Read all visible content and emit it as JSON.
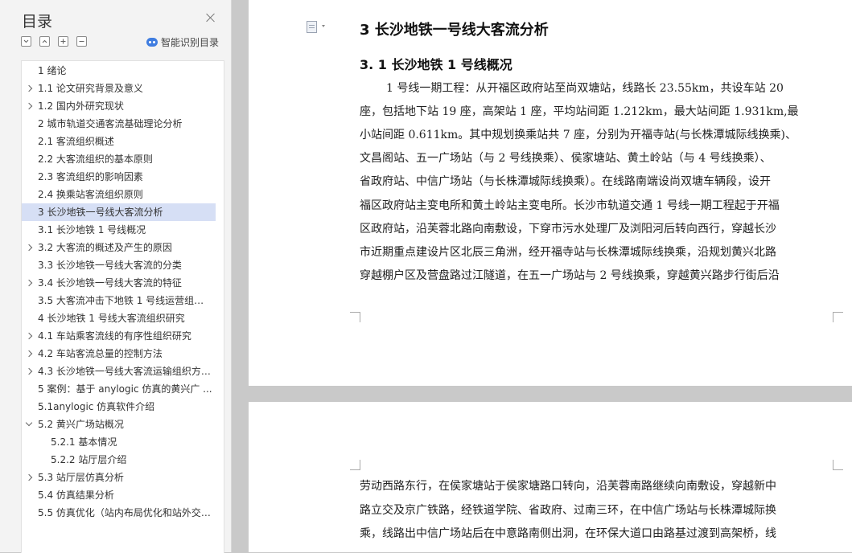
{
  "sidebar": {
    "title": "目录",
    "smart_label": "智能识别目录",
    "items": [
      {
        "label": "1 绪论",
        "expandable": false,
        "level": 1
      },
      {
        "label": "1.1 论文研究背景及意义",
        "expandable": true,
        "level": 1
      },
      {
        "label": "1.2 国内外研究现状",
        "expandable": true,
        "level": 1
      },
      {
        "label": "2 城市轨道交通客流基础理论分析",
        "expandable": false,
        "level": 1
      },
      {
        "label": "2.1 客流组织概述",
        "expandable": false,
        "level": 1
      },
      {
        "label": "2.2 大客流组织的基本原则",
        "expandable": false,
        "level": 1
      },
      {
        "label": "2.3 客流组织的影响因素",
        "expandable": false,
        "level": 1
      },
      {
        "label": "2.4 换乘站客流组织原则",
        "expandable": false,
        "level": 1
      },
      {
        "label": "3 长沙地铁一号线大客流分析",
        "expandable": false,
        "level": 1,
        "selected": true
      },
      {
        "label": "3.1 长沙地铁 1 号线概况",
        "expandable": false,
        "level": 1
      },
      {
        "label": "3.2 大客流的概述及产生的原因",
        "expandable": true,
        "level": 1
      },
      {
        "label": "3.3 长沙地铁一号线大客流的分类",
        "expandable": false,
        "level": 1
      },
      {
        "label": "3.4 长沙地铁一号线大客流的特征",
        "expandable": true,
        "level": 1
      },
      {
        "label": "3.5 大客流冲击下地铁 1 号线运营组织 ...",
        "expandable": false,
        "level": 1
      },
      {
        "label": "4 长沙地铁 1 号线大客流组织研究",
        "expandable": false,
        "level": 1
      },
      {
        "label": "4.1 车站乘客流线的有序性组织研究",
        "expandable": true,
        "level": 1
      },
      {
        "label": "4.2 车站客流总量的控制方法",
        "expandable": true,
        "level": 1
      },
      {
        "label": "4.3 长沙地铁一号线大客流运输组织方 ...",
        "expandable": true,
        "level": 1
      },
      {
        "label": "5 案例：基于 anylogic 仿真的黄兴广 ...",
        "expandable": false,
        "level": 1
      },
      {
        "label": "5.1anylogic 仿真软件介绍",
        "expandable": false,
        "level": 1
      },
      {
        "label": "5.2 黄兴广场站概况",
        "expandable": true,
        "expanded": true,
        "level": 1
      },
      {
        "label": "5.2.1 基本情况",
        "expandable": false,
        "level": 2
      },
      {
        "label": "5.2.2 站厅层介绍",
        "expandable": false,
        "level": 2
      },
      {
        "label": "5.3 站厅层仿真分析",
        "expandable": true,
        "level": 1
      },
      {
        "label": "5.4 仿真结果分析",
        "expandable": false,
        "level": 1
      },
      {
        "label": "5.5 仿真优化（站内布局优化和站外交 ...",
        "expandable": false,
        "level": 1
      }
    ]
  },
  "document": {
    "heading1": "3 长沙地铁一号线大客流分析",
    "heading2": "3. 1 长沙地铁 1 号线概况",
    "page1_lines": [
      "1 号线一期工程：从开福区政府站至尚双塘站，线路长 23.55km，共设车站 20",
      "座，包括地下站 19 座，高架站 1 座，平均站间距 1.212km，最大站间距 1.931km,最",
      "小站间距 0.611km。其中规划换乘站共 7 座，分别为开福寺站(与长株潭城际线换乘)、",
      "文昌阁站、五一广场站（与 2 号线换乘）、侯家塘站、黄土岭站（与 4 号线换乘）、",
      "省政府站、中信广场站（与长株潭城际线换乘）。在线路南端设尚双塘车辆段，设开",
      "福区政府站主变电所和黄土岭站主变电所。长沙市轨道交通 1 号线一期工程起于开福",
      "区政府站，沿芙蓉北路向南敷设，下穿市污水处理厂及浏阳河后转向西行，穿越长沙",
      "市近期重点建设片区北辰三角洲，经开福寺站与长株潭城际线换乘，沿规划黄兴北路",
      "穿越棚户区及营盘路过江隧道，在五一广场站与 2 号线换乘，穿越黄兴路步行街后沿"
    ],
    "page2_lines": [
      "劳动西路东行，在侯家塘站于侯家塘路口转向，沿芙蓉南路继续向南敷设，穿越新中",
      "路立交及京广铁路，经铁道学院、省政府、过南三环，在中信广场站与长株潭城际换",
      "乘，线路出中信广场站后在中意路南侧出洞，在环保大道口由路基过渡到高架桥，线"
    ]
  }
}
